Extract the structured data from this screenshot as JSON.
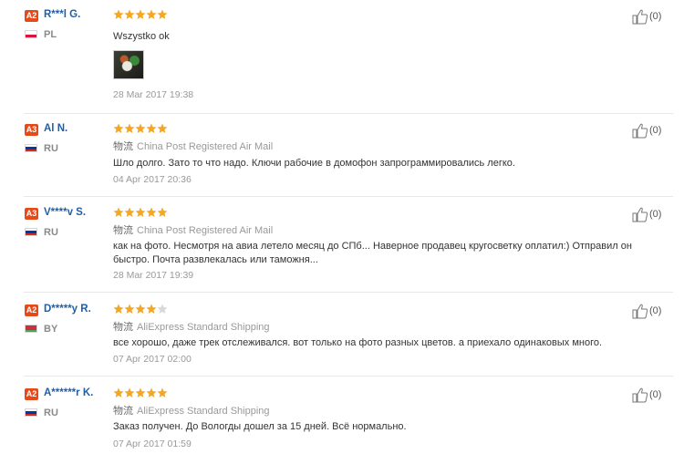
{
  "colors": {
    "star": "#f5a623",
    "star_empty": "#d8d8d8",
    "name": "#1f5fa8",
    "badge": "#e64a19"
  },
  "reviews": [
    {
      "level": "A2",
      "name": "R***l G.",
      "country": "PL",
      "flag": [
        "#ffffff",
        "#dc143c"
      ],
      "stars": 5,
      "shipping_cn": "",
      "shipping": "",
      "text": "Wszystko ok",
      "date": "28 Mar 2017 19:38",
      "likes": "(0)",
      "has_image": true
    },
    {
      "level": "A3",
      "name": "Al N.",
      "country": "RU",
      "flag": [
        "#ffffff",
        "#0039a6",
        "#d52b1e"
      ],
      "stars": 5,
      "shipping_cn": "物流",
      "shipping": "China Post Registered Air Mail",
      "text": "Шло долго. Зато то что надо. Ключи рабочие в домофон запрограммировались легко.",
      "date": "04 Apr 2017 20:36",
      "likes": "(0)",
      "has_image": false
    },
    {
      "level": "A3",
      "name": "V****v S.",
      "country": "RU",
      "flag": [
        "#ffffff",
        "#0039a6",
        "#d52b1e"
      ],
      "stars": 5,
      "shipping_cn": "物流",
      "shipping": "China Post Registered Air Mail",
      "text": "как на фото. Несмотря на авиа летело месяц до СПб... Наверное продавец кругосветку оплатил:) Отправил он быстро. Почта развлекалась или таможня...",
      "date": "28 Mar 2017 19:39",
      "likes": "(0)",
      "has_image": false
    },
    {
      "level": "A2",
      "name": "D*****y R.",
      "country": "BY",
      "flag": [
        "#c8313e",
        "#c8313e",
        "#4aa657"
      ],
      "stars": 4,
      "shipping_cn": "物流",
      "shipping": "AliExpress Standard Shipping",
      "text": "все хорошо, даже трек отслеживался. вот только на фото разных цветов. а приехало одинаковых много.",
      "date": "07 Apr 2017 02:00",
      "likes": "(0)",
      "has_image": false
    },
    {
      "level": "A2",
      "name": "A******r K.",
      "country": "RU",
      "flag": [
        "#ffffff",
        "#0039a6",
        "#d52b1e"
      ],
      "stars": 5,
      "shipping_cn": "物流",
      "shipping": "AliExpress Standard Shipping",
      "text": "Заказ получен. До Вологды дошел за 15 дней. Всё нормально.",
      "date": "07 Apr 2017 01:59",
      "likes": "(0)",
      "has_image": false
    }
  ]
}
